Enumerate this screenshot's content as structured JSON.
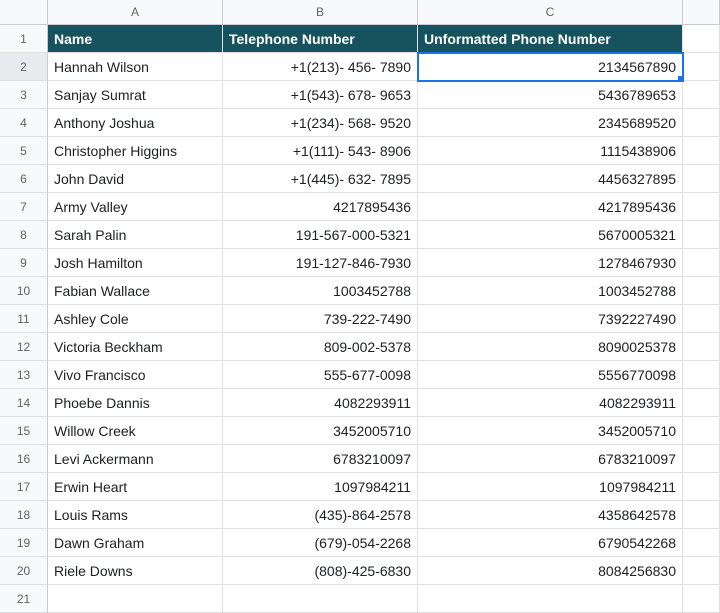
{
  "columns": [
    "A",
    "B",
    "C"
  ],
  "headers": {
    "A": "Name",
    "B": "Telephone Number",
    "C": "Unformatted Phone Number"
  },
  "activeCell": "C2",
  "rows": [
    {
      "n": "2",
      "A": "Hannah Wilson",
      "B": "+1(213)- 456- 7890",
      "C": "2134567890"
    },
    {
      "n": "3",
      "A": "Sanjay Sumrat",
      "B": "+1(543)- 678- 9653",
      "C": "5436789653"
    },
    {
      "n": "4",
      "A": "Anthony Joshua",
      "B": "+1(234)- 568- 9520",
      "C": "2345689520"
    },
    {
      "n": "5",
      "A": "Christopher Higgins",
      "B": "+1(111)- 543- 8906",
      "C": "1115438906"
    },
    {
      "n": "6",
      "A": "John David",
      "B": "+1(445)- 632- 7895",
      "C": "4456327895"
    },
    {
      "n": "7",
      "A": "Army Valley",
      "B": "4217895436",
      "C": "4217895436"
    },
    {
      "n": "8",
      "A": "Sarah Palin",
      "B": "191-567-000-5321",
      "C": "5670005321"
    },
    {
      "n": "9",
      "A": "Josh Hamilton",
      "B": "191-127-846-7930",
      "C": "1278467930"
    },
    {
      "n": "10",
      "A": "Fabian Wallace",
      "B": "1003452788",
      "C": "1003452788"
    },
    {
      "n": "11",
      "A": "Ashley Cole",
      "B": "739-222-7490",
      "C": "7392227490"
    },
    {
      "n": "12",
      "A": "Victoria Beckham",
      "B": "809-002-5378",
      "C": "8090025378"
    },
    {
      "n": "13",
      "A": "Vivo Francisco",
      "B": "555-677-0098",
      "C": "5556770098"
    },
    {
      "n": "14",
      "A": "Phoebe Dannis",
      "B": "4082293911",
      "C": "4082293911"
    },
    {
      "n": "15",
      "A": "Willow Creek",
      "B": "3452005710",
      "C": "3452005710"
    },
    {
      "n": "16",
      "A": "Levi Ackermann",
      "B": "6783210097",
      "C": "6783210097"
    },
    {
      "n": "17",
      "A": "Erwin Heart",
      "B": "1097984211",
      "C": "1097984211"
    },
    {
      "n": "18",
      "A": "Louis Rams",
      "B": "(435)-864-2578",
      "C": "4358642578"
    },
    {
      "n": "19",
      "A": "Dawn Graham",
      "B": "(679)-054-2268",
      "C": "6790542268"
    },
    {
      "n": "20",
      "A": "Riele Downs",
      "B": "(808)-425-6830",
      "C": "8084256830"
    }
  ],
  "emptyRow": "21"
}
